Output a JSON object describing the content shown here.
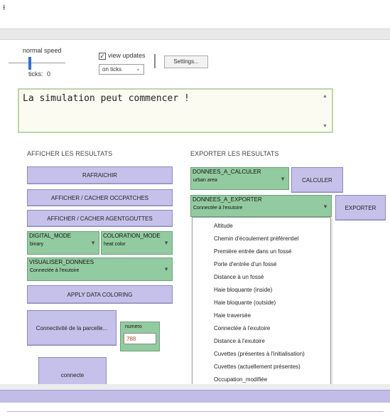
{
  "top_glyph": "ɫ",
  "controls": {
    "speed_label": "normal speed",
    "ticks_label": "ticks:",
    "ticks_value": "0",
    "view_updates_checked": true,
    "checkmark": "✓",
    "view_updates_label": "view updates",
    "update_mode": "on ticks",
    "settings_label": "Settings..."
  },
  "output": {
    "text": "La simulation peut commencer !",
    "scroll_up": "▲",
    "scroll_down": "▼"
  },
  "left_panel": {
    "title": "AFFICHER LES RESULTATS",
    "refresh_button": "RAFRAICHIR",
    "toggle_occpatches_button": "AFFICHER / CACHER OCCPATCHES",
    "toggle_agentgouttes_button": "AFFICHER / CACHER AGENTGOUTTES",
    "digital_mode": {
      "label": "DIGITAL_MODE",
      "value": "binary"
    },
    "coloration_mode": {
      "label": "COLORATION_MODE",
      "value": "heat color"
    },
    "visualiser": {
      "label": "VISUALISER_DONNEES",
      "value": "Connectée à l'exutoire"
    },
    "apply_button": "APPLY DATA COLORING",
    "connectivity_button": "Connectivité de la parcelle...",
    "numero": {
      "label": "numero",
      "value": "788"
    },
    "connecte_button": "connecte"
  },
  "right_panel": {
    "title": "EXPORTER LES RESULTATS",
    "donnees_calculer": {
      "label": "DONNEES_A_CALCULER",
      "value": "urban area"
    },
    "calculer_button": "CALCULER",
    "donnees_exporter": {
      "label": "DONNEES_A_EXPORTER",
      "value": "Connectée à l'exutoire"
    },
    "exporter_button": "EXPORTER"
  },
  "dropdown_options": [
    "Altitude",
    "Chemin d'écoulement préférentiel",
    "Première entrée dans un fossé",
    "Porte d'entrée d'un fossé",
    "Distance à un fossé",
    "Haie bloquante (inside)",
    "Haie bloquante (outside)",
    "Haie traversée",
    "Connectée à l'exutoire",
    "Distance à l'exutoire",
    "Cuvettes (présentes à l'initialisation)",
    "Cuvettes (actuellement présentes)",
    "Occupation_modifiée"
  ],
  "icons": {
    "dropdown_arrow": "▼",
    "chevron_down": "⌄"
  },
  "colors": {
    "button_purple": "#c5c1ea",
    "chooser_green": "#93cba0",
    "output_border": "#bdd6a8",
    "monitor_value": "#b24a2b"
  }
}
